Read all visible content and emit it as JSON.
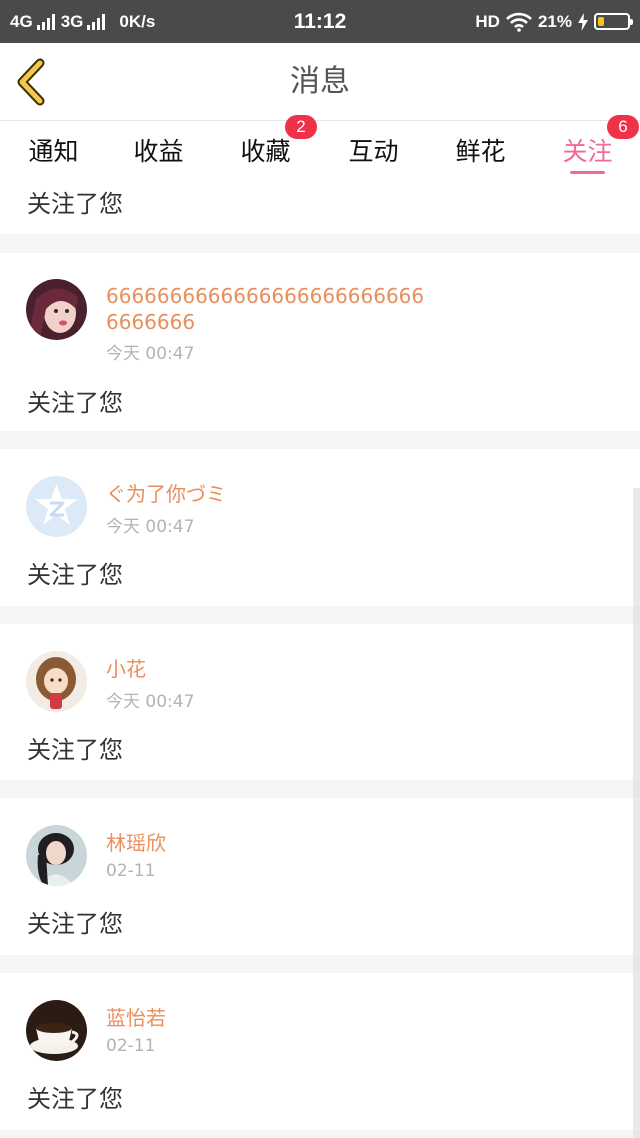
{
  "status_bar": {
    "net1": "4G",
    "net2": "3G",
    "speed": "0K/s",
    "time": "11:12",
    "hd": "HD",
    "battery_pct": "21%",
    "battery_level": 0.21
  },
  "header": {
    "title": "消息",
    "back_icon": "chevron-left-icon"
  },
  "tabs": [
    {
      "label": "通知",
      "badge": ""
    },
    {
      "label": "收益",
      "badge": ""
    },
    {
      "label": "收藏",
      "badge": "2"
    },
    {
      "label": "互动",
      "badge": ""
    },
    {
      "label": "鲜花",
      "badge": ""
    },
    {
      "label": "关注",
      "badge": "6",
      "active": true
    }
  ],
  "partial_item": {
    "action": "关注了您"
  },
  "items": [
    {
      "name": "66666666666666666666666666666666",
      "time": "今天 00:47",
      "action": "关注了您"
    },
    {
      "name": "ぐ为了你づミ",
      "time": "今天 00:47",
      "action": "关注了您"
    },
    {
      "name": "小花",
      "time": "今天 00:47",
      "action": "关注了您"
    },
    {
      "name": "林瑶欣",
      "time": "02-11",
      "action": "关注了您"
    },
    {
      "name": "蓝怡若",
      "time": "02-11",
      "action": "关注了您"
    }
  ],
  "colors": {
    "accent": "#ef6b9b",
    "badge": "#f0314a",
    "nickname": "#e98e5c",
    "back_icon": "#f2c94c"
  }
}
